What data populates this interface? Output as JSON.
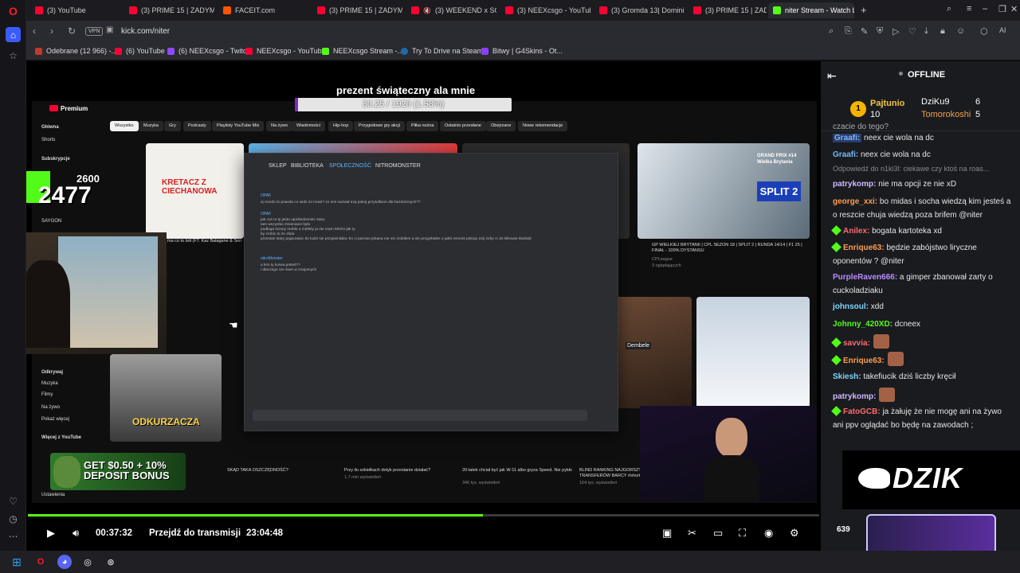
{
  "browser": {
    "tabs": [
      {
        "label": "(3) YouTube",
        "icon": "youtube-icon"
      },
      {
        "label": "(3) PRIME 15 | ZADYMA",
        "icon": "youtube-icon"
      },
      {
        "label": "FACEIT.com",
        "icon": "faceit-icon"
      },
      {
        "label": "(3) PRIME 15 | ZADYMA",
        "icon": "youtube-icon"
      },
      {
        "label": "(3) WEEKEND x SOUN",
        "icon": "youtube-icon"
      },
      {
        "label": "(3) NEEXcsgo - YouTube",
        "icon": "youtube-icon"
      },
      {
        "label": "(3) Gromda 13| Dominik A",
        "icon": "youtube-icon"
      },
      {
        "label": "(3) PRIME 15 | ZADYMA",
        "icon": "youtube-icon"
      },
      {
        "label": "niter Stream - Watch Live",
        "icon": "kick-icon",
        "active": true
      }
    ],
    "vpn_label": "VPN",
    "url": "kick.com/niter",
    "bookmarks": [
      {
        "label": "Odebrane (12 966) -...",
        "icon": "mail-icon"
      },
      {
        "label": "(6) YouTube",
        "icon": "youtube-icon"
      },
      {
        "label": "(6) NEEXcsgo - Twitch",
        "icon": "twitch-icon"
      },
      {
        "label": "NEEXcsgo - YouTube",
        "icon": "youtube-icon"
      },
      {
        "label": "NEEXcsgo Stream -...",
        "icon": "kick-icon"
      },
      {
        "label": "Try To Drive na Steam",
        "icon": "steam-icon"
      },
      {
        "label": "Bitwy | G4Skins - Ot...",
        "icon": "g4skins-icon"
      }
    ],
    "ai_label": "AI"
  },
  "stream": {
    "overlay_title": "prezent świąteczny ala mnie",
    "goal_text": "30.25 / 1920 (1.58%)",
    "goal_progress": 0.0158,
    "sub_goal": "2600",
    "sub_count": "2477",
    "promo": {
      "line1": "GET $0.50 + 10%",
      "line2": "DEPOSIT BONUS"
    },
    "youtube": {
      "logo": "Premium",
      "chips": [
        "Wszystko",
        "Muzyka",
        "Gry",
        "Podcasty",
        "Playlisty YouTube Mix",
        "Na żywo",
        "Wiadomości",
        "Hip-hop",
        "Przygodowe gry akcji",
        "Piłka nożna",
        "Ostatnio przesłane",
        "Obejrzane",
        "Nowe rekomendacje"
      ],
      "sidebar": [
        "Główna",
        "Shorts",
        "Subskrypcje",
        "SAYGON",
        "Odkrywaj",
        "Muzyka",
        "Filmy",
        "Na żywo",
        "Pokaż więcej",
        "Więcej z YouTube",
        "Ustawienia"
      ],
      "thumb_texts": [
        "KRETACZ Z CIECHANOWA",
        "ODKURZACZA",
        "SPLIT 2",
        "GRAND PRIX #14 Wielka Brytania",
        "Dembele"
      ],
      "captions": [
        "ma co to bół (FT. Kaz Bałagane & Sen",
        "GP WIELKIEJ BRYTANII | CPL SEZON 18 | SPLIT 2 | RUNDA 14/14 | F1 25 | FINAŁ - 100% DYSTANSU",
        "SKĄD TAKA OSZCZĘDNOŚĆ?",
        "Przy ilu szkiełkach dotyk przestanie działać?",
        "20-latek chciał być jak W-11 albo gryza Speed. Nie pykło",
        "BLIND RANKING NAJGORSZYCH TRANSFERÓW BARCY #shorts"
      ],
      "caption_subs": [
        "CPLeague",
        "3 oglądających",
        "1,7 mln wyświetleń",
        "346 tys. wyświetleń",
        "164 tys. wyświetleń"
      ]
    },
    "discord": {
      "nav": [
        "SKLEP",
        "BIBLIOTEKA",
        "SPOŁECZNOŚĆ",
        "NITROMONSTER"
      ],
      "messages": [
        {
          "name": "OPAF",
          "lines": [
            "ej mordo to prawda co widz mi mowi? ze zes nazwał moj pokoj przytulkiem dla bezdomnych??"
          ]
        },
        {
          "name": "OPAF",
          "lines": [
            "jak cos to ty jesto upośledzeniec stary",
            "tam wszystko zmieniane było",
            "podłoga ściany meble a meblity ja nie mam 50min jak ty",
            "by zrobic to że złota",
            "przestan stary pajacowac do ludzi sie przypierdalac bo ci parowo jebana nie nie zrobiłem a sie przyjebales o jakis remont pokoju mój żeby ci 15 lełkowie klaskali"
          ]
        },
        {
          "name": "nitroMonster",
          "lines": [
            "a kim ty kurwa jesteś??",
            "i dlaczego cie mam w znajomych"
          ]
        }
      ]
    }
  },
  "player": {
    "elapsed": "00:37:32",
    "jump_label": "Przejdź do transmisji",
    "live_time": "23:04:48",
    "progress": 0.575
  },
  "chat": {
    "status": "OFFLINE",
    "leaders": [
      {
        "name": "Pajtunio",
        "count": "10"
      },
      {
        "name": "DziKu9",
        "count": "6"
      },
      {
        "name": "Tomorokoshi",
        "count": "5"
      }
    ],
    "top_partial": "czacie do tego?",
    "messages": [
      {
        "user": "Graafi:",
        "text": " neex cie wola na dc",
        "color": "#79b8ff",
        "highlight": true
      },
      {
        "user": "Graafi:",
        "text": " neex cie wola na dc",
        "color": "#79b8ff"
      },
      {
        "reply": "Odpowiedź do n1ki3l: ciekawe czy ktoś na roas..."
      },
      {
        "user": "patrykomp:",
        "text": " nie ma opcji ze nie xD",
        "color": "#d3b8ff"
      },
      {
        "user": "george_xxi:",
        "text": " bo midas i socha wiedzą kim jesteś a o reszcie chuja wiedzą poza brifem @niter",
        "color": "#ff9d4d"
      },
      {
        "user": "Anilex:",
        "text": " bogata kartoteka xd",
        "color": "#ff6b6b",
        "badge": true
      },
      {
        "user": "Enrique63:",
        "text": " będzie zabójstwo liryczne oponentów ? @niter",
        "color": "#ff9d4d",
        "badge": true
      },
      {
        "user": "PurpleRaven666:",
        "text": " a gimper zbanował zarty o cuckoladziaku",
        "color": "#b98cff"
      },
      {
        "user": "johnsoul:",
        "text": " xdd",
        "color": "#7fd6ff"
      },
      {
        "user": "Johnny_420XD:",
        "text": " dcneex",
        "color": "#53fc18"
      },
      {
        "user": "savvia:",
        "text": "",
        "color": "#ff6b6b",
        "badge": true,
        "emote": true
      },
      {
        "user": "Enrique63:",
        "text": "",
        "color": "#ff9d4d",
        "badge": true,
        "emote": true
      },
      {
        "user": "Skiesh:",
        "text": " takefiucik dziś liczby kręcił",
        "color": "#7fd6ff"
      },
      {
        "user": "patrykomp:",
        "text": "",
        "color": "#d3b8ff",
        "emote": true
      },
      {
        "user": "FatoGCB:",
        "text": " ja żałuję że nie mogę ani na żywo ani ppv oglądać bo będę na zawodach ;",
        "color": "#ff6b6b",
        "badge": true
      }
    ],
    "dzik_label": "DZIK",
    "viewers": "639"
  },
  "colors": {
    "kick_green": "#53fc18",
    "youtube_red": "#ff0033",
    "goal_purple": "#7b2cbf"
  }
}
